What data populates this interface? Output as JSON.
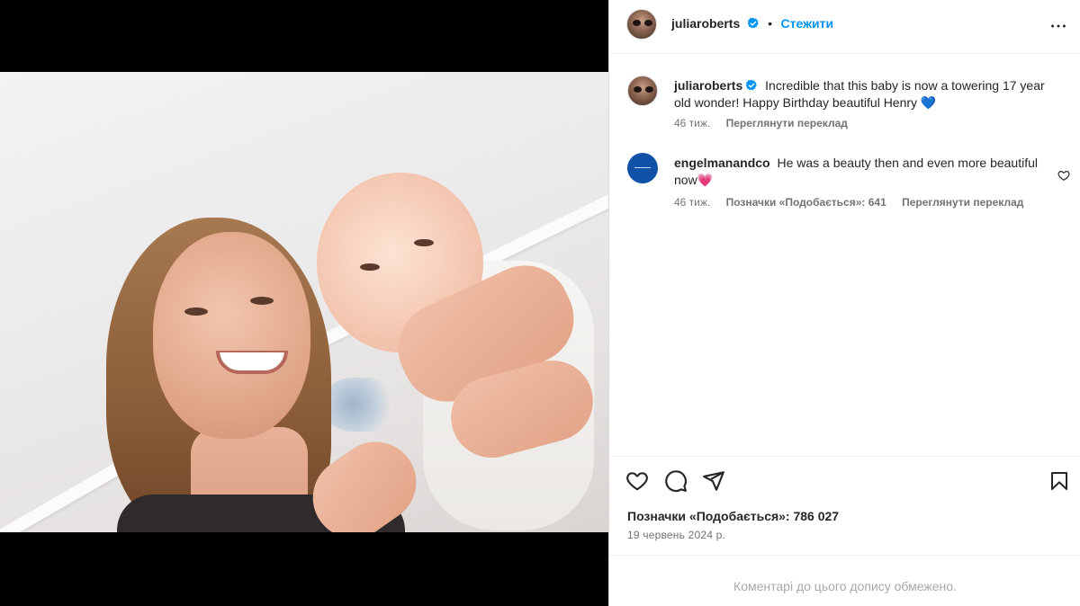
{
  "post": {
    "author": "juliaroberts",
    "follow_label": "Стежити",
    "dot_separator": "•",
    "caption": {
      "username": "juliaroberts",
      "text": "Incredible that this baby is now a towering 17 year old wonder! Happy Birthday beautiful Henry 💙",
      "age": "46 тиж.",
      "translate_label": "Переглянути переклад"
    },
    "comments": [
      {
        "username": "engelmanandco",
        "text": "He was a beauty then and even more beautiful now💗",
        "age": "46 тиж.",
        "likes_label": "Позначки «Подобається»: 641",
        "translate_label": "Переглянути переклад"
      }
    ],
    "likes_label": "Позначки «Подобається»: 786 027",
    "date": "19 червень 2024 р.",
    "comments_limited": "Коментарі до цього допису обмежено."
  },
  "icons": {
    "more": "more-horizontal-icon",
    "verified": "verified-badge-icon",
    "like": "heart-icon",
    "comment": "comment-icon",
    "share": "share-icon",
    "save": "bookmark-icon"
  },
  "colors": {
    "follow": "#0095f6",
    "verified": "#0095f6",
    "muted_text": "#737373",
    "comment_avatar": "#0f52a8"
  }
}
